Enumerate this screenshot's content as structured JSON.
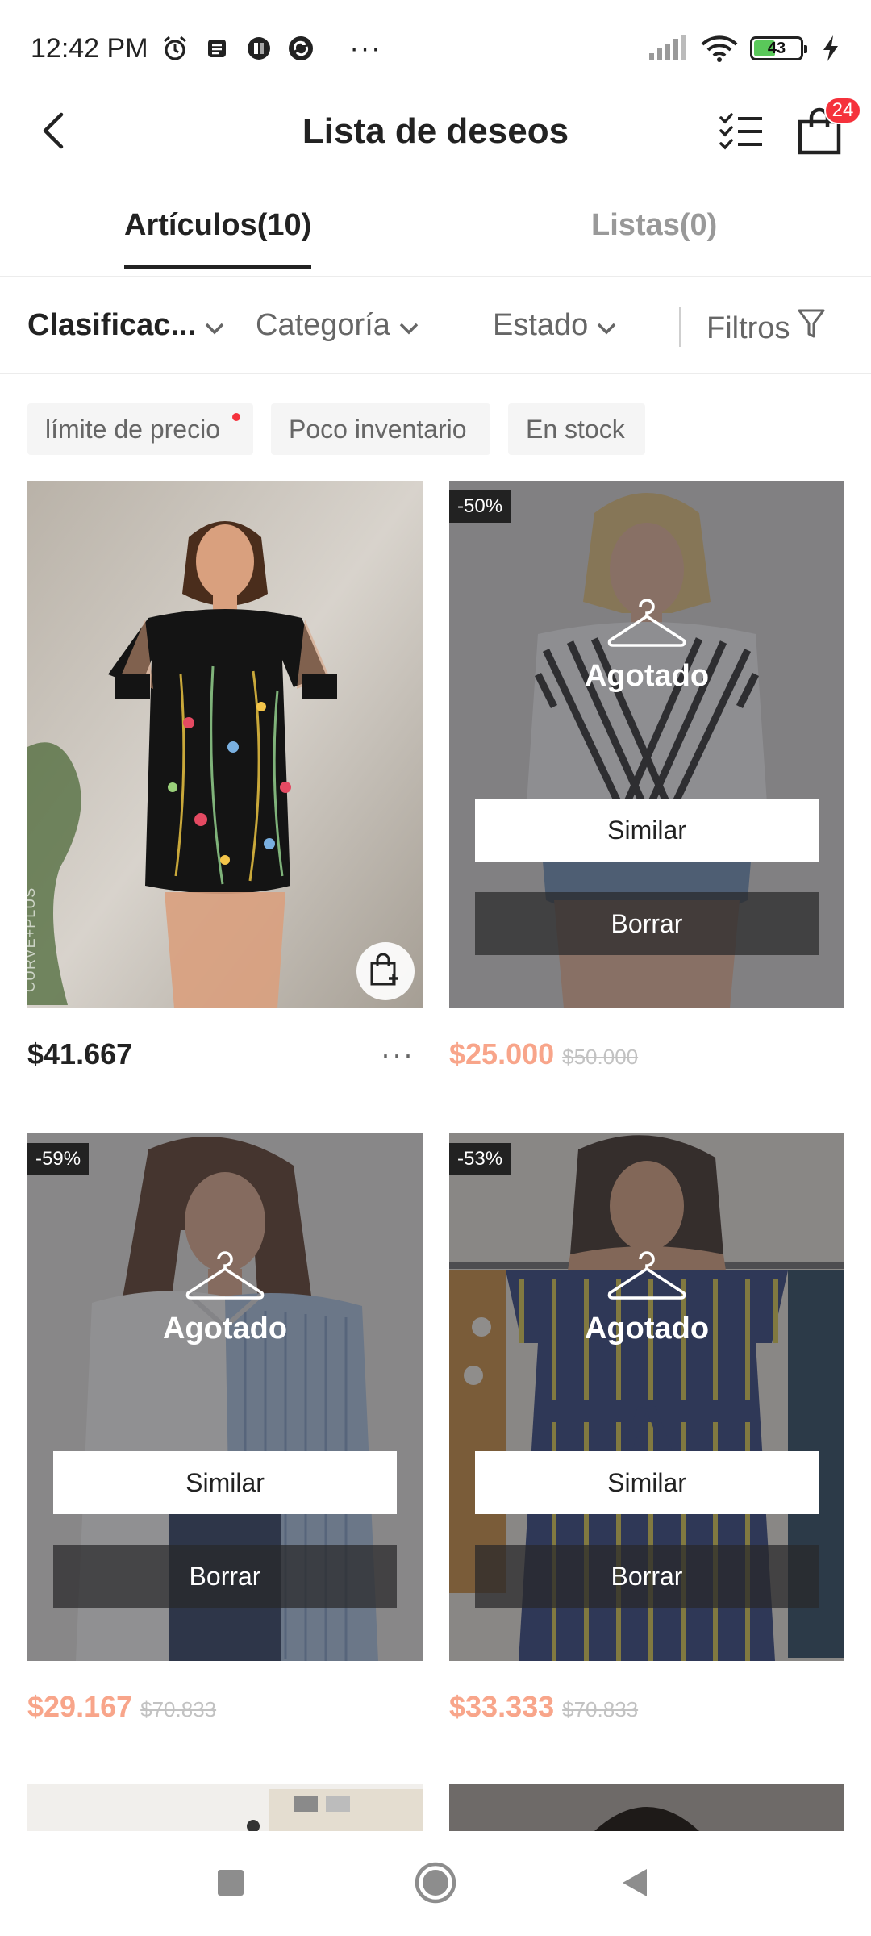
{
  "status_bar": {
    "time": "12:42 PM",
    "more": "···",
    "battery": "43",
    "icons": [
      "alarm-icon",
      "notes-icon",
      "app-icon",
      "sync-icon",
      "signal-icon",
      "wifi-icon",
      "battery-icon",
      "charging-icon"
    ]
  },
  "header": {
    "title": "Lista de deseos",
    "cart_count": "24",
    "icons": [
      "back-arrow-icon",
      "checklist-icon",
      "shopping-bag-icon"
    ]
  },
  "tabs": [
    {
      "label": "Artículos(10)",
      "active": true
    },
    {
      "label": "Listas(0)",
      "active": false
    }
  ],
  "filters": {
    "sort": "Clasificac...",
    "category": "Categoría",
    "status": "Estado",
    "filters": "Filtros"
  },
  "chips": [
    {
      "label": "límite de precio",
      "has_dot": true
    },
    {
      "label": "Poco inventario",
      "has_dot": false
    },
    {
      "label": "En stock",
      "has_dot": false
    }
  ],
  "products": [
    {
      "price": "$41.667",
      "old_price": "",
      "discount": "",
      "sold_out": false,
      "brand_watermark": "CURVE+PLUS",
      "more": "···"
    },
    {
      "price": "$25.000",
      "old_price": "$50.000",
      "discount": "-50%",
      "sold_out": true,
      "sold_out_label": "Agotado",
      "similar_label": "Similar",
      "delete_label": "Borrar"
    },
    {
      "price": "$29.167",
      "old_price": "$70.833",
      "discount": "-59%",
      "sold_out": true,
      "sold_out_label": "Agotado",
      "similar_label": "Similar",
      "delete_label": "Borrar"
    },
    {
      "price": "$33.333",
      "old_price": "$70.833",
      "discount": "-53%",
      "sold_out": true,
      "sold_out_label": "Agotado",
      "similar_label": "Similar",
      "delete_label": "Borrar"
    }
  ],
  "colors": {
    "accent_red": "#f5323c",
    "sale_price": "#f8a58a",
    "text_primary": "#222222",
    "text_secondary": "#666666"
  }
}
